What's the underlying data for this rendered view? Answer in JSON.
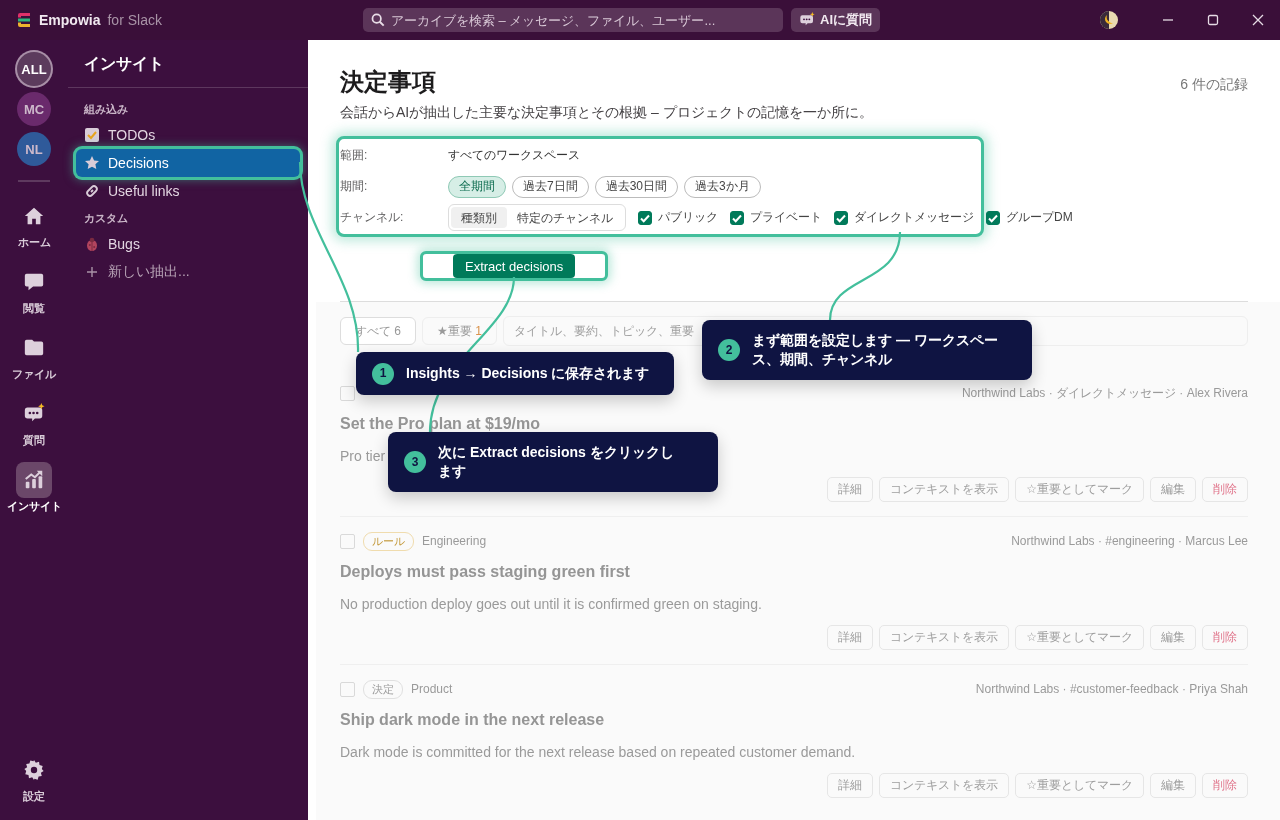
{
  "titlebar": {
    "app_name": "Empowia",
    "app_suffix": "for Slack",
    "search": {
      "placeholder": "アーカイブを検索 – メッセージ、ファイル、ユーザー..."
    },
    "ask_ai": "AIに質問"
  },
  "workspaces": [
    {
      "label": "ALL",
      "selected": true
    },
    {
      "label": "MC",
      "selected": false
    },
    {
      "label": "NL",
      "selected": false
    }
  ],
  "rail": [
    {
      "kind": "home",
      "label": "ホーム",
      "selected": false
    },
    {
      "kind": "browse",
      "label": "閲覧",
      "selected": false
    },
    {
      "kind": "files",
      "label": "ファイル",
      "selected": false
    },
    {
      "kind": "ask",
      "label": "質問",
      "selected": false
    },
    {
      "kind": "insights",
      "label": "インサイト",
      "selected": true
    },
    {
      "kind": "settings",
      "label": "設定",
      "selected": false
    }
  ],
  "sidebar": {
    "title": "インサイト",
    "sections": [
      {
        "heading": "組み込み",
        "items": [
          {
            "kind": "todo",
            "label": "TODOs",
            "selected": false,
            "highlighted": false
          },
          {
            "kind": "star",
            "label": "Decisions",
            "selected": true,
            "highlighted": true
          },
          {
            "kind": "link",
            "label": "Useful links",
            "selected": false,
            "highlighted": false
          }
        ]
      },
      {
        "heading": "カスタム",
        "items": [
          {
            "kind": "bug",
            "label": "Bugs",
            "selected": false,
            "highlighted": false
          },
          {
            "kind": "add",
            "label": "新しい抽出...",
            "selected": false,
            "highlighted": false
          }
        ]
      }
    ]
  },
  "page": {
    "title": "決定事項",
    "subtitle": "会話からAIが抽出した主要な決定事項とその根拠 – プロジェクトの記憶を一か所に。",
    "count": "6 件の記録"
  },
  "filters": {
    "highlighted": true,
    "scope": {
      "label": "範囲:",
      "value": "すべてのワークスペース"
    },
    "period": {
      "label": "期間:",
      "options": [
        {
          "label": "全期間",
          "selected": true
        },
        {
          "label": "過去7日間",
          "selected": false
        },
        {
          "label": "過去30日間",
          "selected": false
        },
        {
          "label": "過去3か月",
          "selected": false
        }
      ]
    },
    "channels": {
      "label": "チャンネル:",
      "modes": [
        {
          "label": "種類別",
          "selected": true
        },
        {
          "label": "特定のチャンネル",
          "selected": false
        }
      ],
      "types": [
        {
          "label": "パブリック",
          "checked": true
        },
        {
          "label": "プライベート",
          "checked": true
        },
        {
          "label": "ダイレクトメッセージ",
          "checked": true
        },
        {
          "label": "グループDM",
          "checked": true
        }
      ]
    }
  },
  "extract_button": {
    "label": "Extract decisions",
    "highlighted": true
  },
  "list_filter": {
    "tabs": [
      {
        "label": "すべて",
        "count": "6",
        "selected": true
      },
      {
        "label": "★重要",
        "count": "1",
        "selected": false
      }
    ],
    "search": {
      "placeholder": "タイトル、要約、トピック、重要"
    }
  },
  "records": [
    {
      "checked": false,
      "meta": "Northwind Labs · ダイレクトメッセージ · Alex Rivera",
      "title": "Set the Pro plan at $19/mo",
      "summary": "Pro tier",
      "actions": [
        {
          "label": "詳細",
          "kind": "normal"
        },
        {
          "label": "コンテキストを表示",
          "kind": "normal"
        },
        {
          "label": "☆重要としてマーク",
          "kind": "normal"
        },
        {
          "label": "編集",
          "kind": "normal"
        },
        {
          "label": "削除",
          "kind": "danger"
        }
      ]
    },
    {
      "checked": false,
      "tag": {
        "label": "ルール",
        "kind": "rule"
      },
      "category": "Engineering",
      "meta": "Northwind Labs · #engineering · Marcus Lee",
      "title": "Deploys must pass staging green first",
      "summary": "No production deploy goes out until it is confirmed green on staging.",
      "actions": [
        {
          "label": "詳細",
          "kind": "normal"
        },
        {
          "label": "コンテキストを表示",
          "kind": "normal"
        },
        {
          "label": "☆重要としてマーク",
          "kind": "normal"
        },
        {
          "label": "編集",
          "kind": "normal"
        },
        {
          "label": "削除",
          "kind": "danger"
        }
      ]
    },
    {
      "checked": false,
      "tag": {
        "label": "決定",
        "kind": "decision"
      },
      "category": "Product",
      "meta": "Northwind Labs · #customer-feedback · Priya Shah",
      "title": "Ship dark mode in the next release",
      "summary": "Dark mode is committed for the next release based on repeated customer demand.",
      "actions": [
        {
          "label": "詳細",
          "kind": "normal"
        },
        {
          "label": "コンテキストを表示",
          "kind": "normal"
        },
        {
          "label": "☆重要としてマーク",
          "kind": "normal"
        },
        {
          "label": "編集",
          "kind": "normal"
        },
        {
          "label": "削除",
          "kind": "danger"
        }
      ]
    }
  ],
  "tour": {
    "steps": [
      {
        "number": "1",
        "text": "Insights → Decisions に保存されます"
      },
      {
        "number": "2",
        "text": "まず範囲を設定します — ワークスペース、期間、チャンネル"
      },
      {
        "number": "3",
        "text": "次に Extract decisions をクリックします"
      }
    ]
  }
}
